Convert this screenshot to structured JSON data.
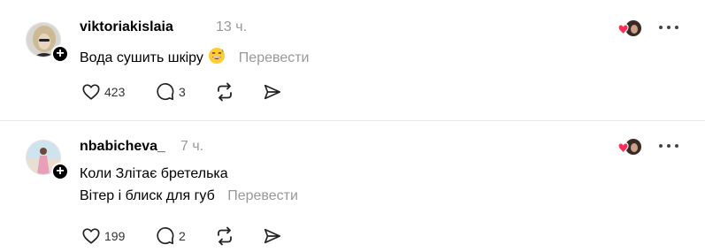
{
  "posts": [
    {
      "username": "viktoriakislaia",
      "time": "13 ч.",
      "lines": [
        "Вода сушить шкіру"
      ],
      "translate_label": "Перевести",
      "likes": "423",
      "comments": "3"
    },
    {
      "username": "nbabicheva_",
      "time": "7 ч.",
      "lines": [
        "Коли Злітає бретелька",
        "Вітер і блиск для губ"
      ],
      "translate_label": "Перевести",
      "likes": "199",
      "comments": "2"
    }
  ],
  "icons": {
    "follow": "plus-icon",
    "like": "heart-icon",
    "comment": "comment-bubble-icon",
    "repost": "repost-icon",
    "share": "send-icon",
    "more": "more-dots-icon",
    "liked_by": "liked-by-avatar-icon"
  },
  "colors": {
    "muted": "#999999",
    "heart": "#ff2a55",
    "divider": "#e6e6e6"
  }
}
